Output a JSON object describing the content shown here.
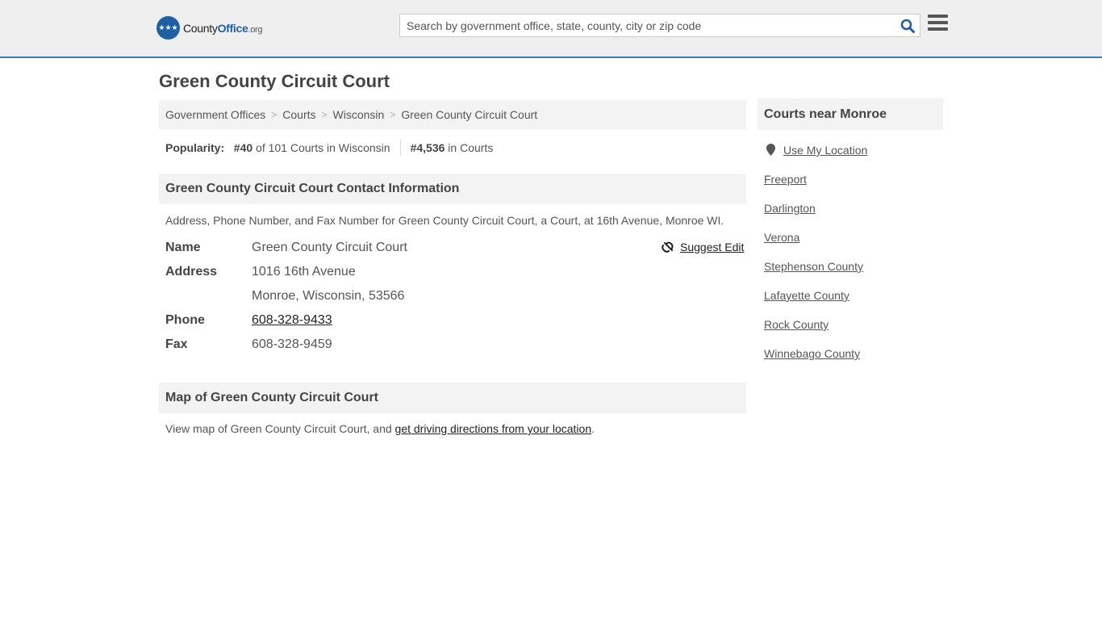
{
  "header": {
    "logo": {
      "part1": "County",
      "part2": "Office",
      "part3": ".org"
    },
    "search_placeholder": "Search by government office, state, county, city or zip code"
  },
  "page_title": "Green County Circuit Court",
  "breadcrumb": [
    "Government Offices",
    "Courts",
    "Wisconsin",
    "Green County Circuit Court"
  ],
  "popularity": {
    "label": "Popularity:",
    "state_rank": "#40",
    "state_text": "of 101 Courts in Wisconsin",
    "national_rank": "#4,536",
    "national_text": "in Courts"
  },
  "contact": {
    "heading": "Green County Circuit Court Contact Information",
    "description": "Address, Phone Number, and Fax Number for Green County Circuit Court, a Court, at 16th Avenue, Monroe WI.",
    "suggest_edit": "Suggest Edit",
    "rows": [
      {
        "label": "Name",
        "value": "Green County Circuit Court"
      },
      {
        "label": "Address",
        "value": "1016 16th Avenue"
      },
      {
        "label": "",
        "value": "Monroe, Wisconsin, 53566"
      },
      {
        "label": "Phone",
        "value": "608-328-9433"
      },
      {
        "label": "Fax",
        "value": "608-328-9459"
      }
    ]
  },
  "map": {
    "heading": "Map of Green County Circuit Court",
    "text": "View map of Green County Circuit Court, and ",
    "link": "get driving directions from your location",
    "end": "."
  },
  "sidebar": {
    "heading": "Courts near Monroe",
    "use_location": "Use My Location",
    "items": [
      "Freeport",
      "Darlington",
      "Verona",
      "Stephenson County",
      "Lafayette County",
      "Rock County",
      "Winnebago County"
    ]
  }
}
